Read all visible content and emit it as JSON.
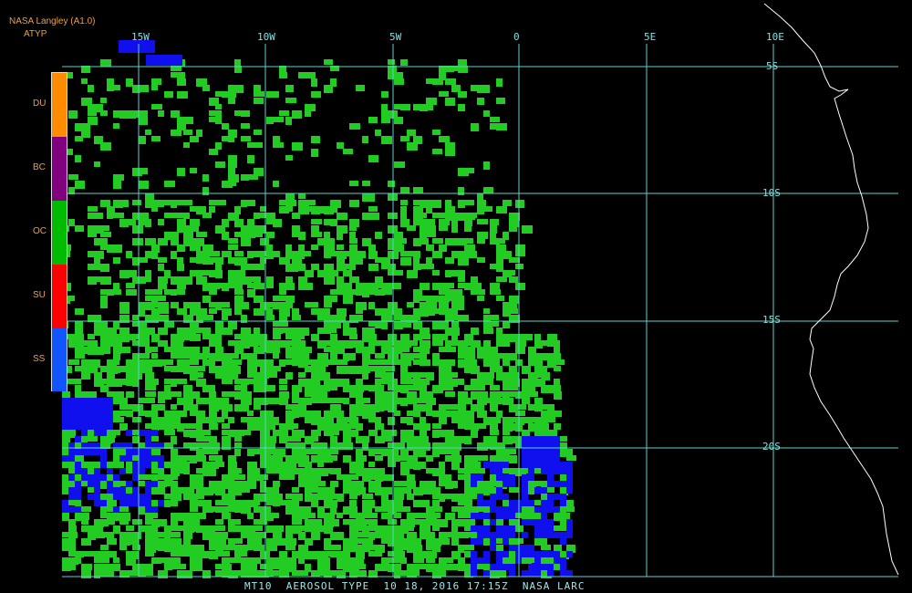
{
  "header": {
    "source": "NASA Langley (A1.0)",
    "product": "ATYP"
  },
  "legend": {
    "items": [
      {
        "label": "DU",
        "color": "#ff8c00"
      },
      {
        "label": "BC",
        "color": "#800080"
      },
      {
        "label": "OC",
        "color": "#00bb00"
      },
      {
        "label": "SU",
        "color": "#ff0000"
      },
      {
        "label": "SS",
        "color": "#1155ff"
      }
    ]
  },
  "grid": {
    "lon_labels": [
      "15W",
      "10W",
      "5W",
      "0",
      "5E",
      "10E"
    ],
    "lat_labels": [
      "5S",
      "10S",
      "15S",
      "20S"
    ],
    "line_color": "#5fd0d0"
  },
  "footer": {
    "caption": "MT10  AEROSOL TYPE  10 18, 2016 17:15Z  NASA LARC"
  },
  "colors": {
    "coast": "#ffffff",
    "oc_pixels": "#22cc22",
    "ss_pixels": "#1010ee"
  }
}
